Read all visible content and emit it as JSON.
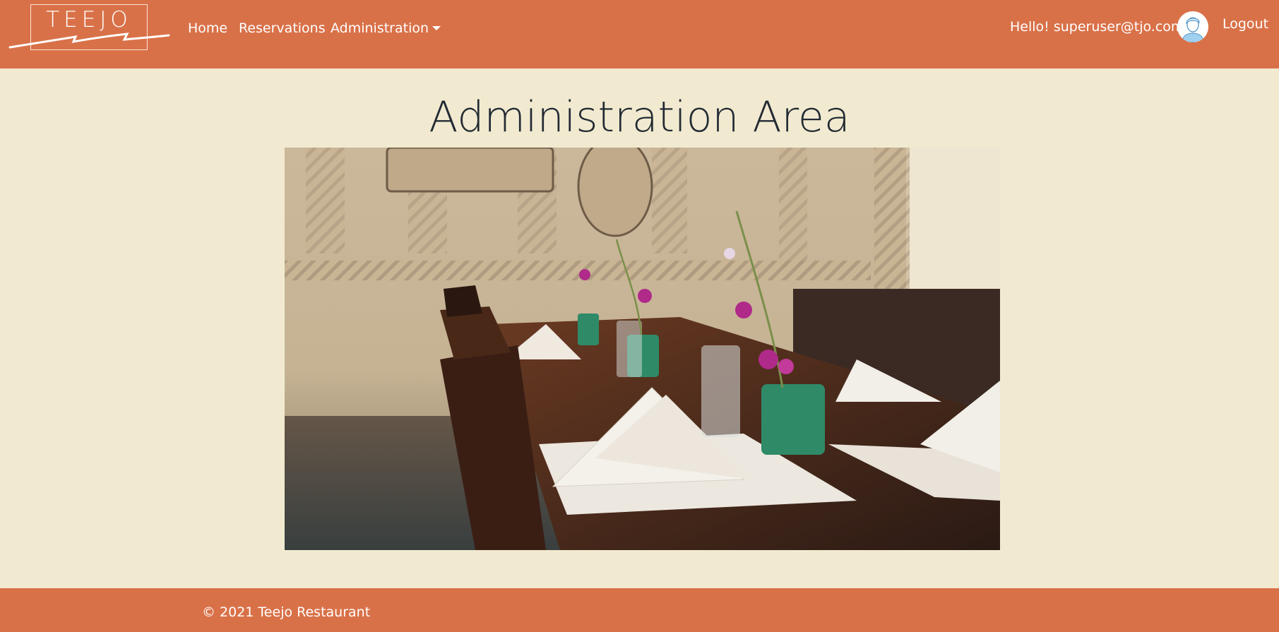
{
  "brand": {
    "name": "TEEJO"
  },
  "nav": {
    "home": "Home",
    "reservations": "Reservations",
    "administration": "Administration"
  },
  "user": {
    "greeting": "Hello! superuser@tjo.com",
    "logout": "Logout"
  },
  "main": {
    "title": "Administration Area"
  },
  "footer": {
    "copyright": "© 2021 Teejo Restaurant"
  },
  "colors": {
    "navbar": "#d97148",
    "background": "#f1ead0",
    "title": "#222a33"
  }
}
